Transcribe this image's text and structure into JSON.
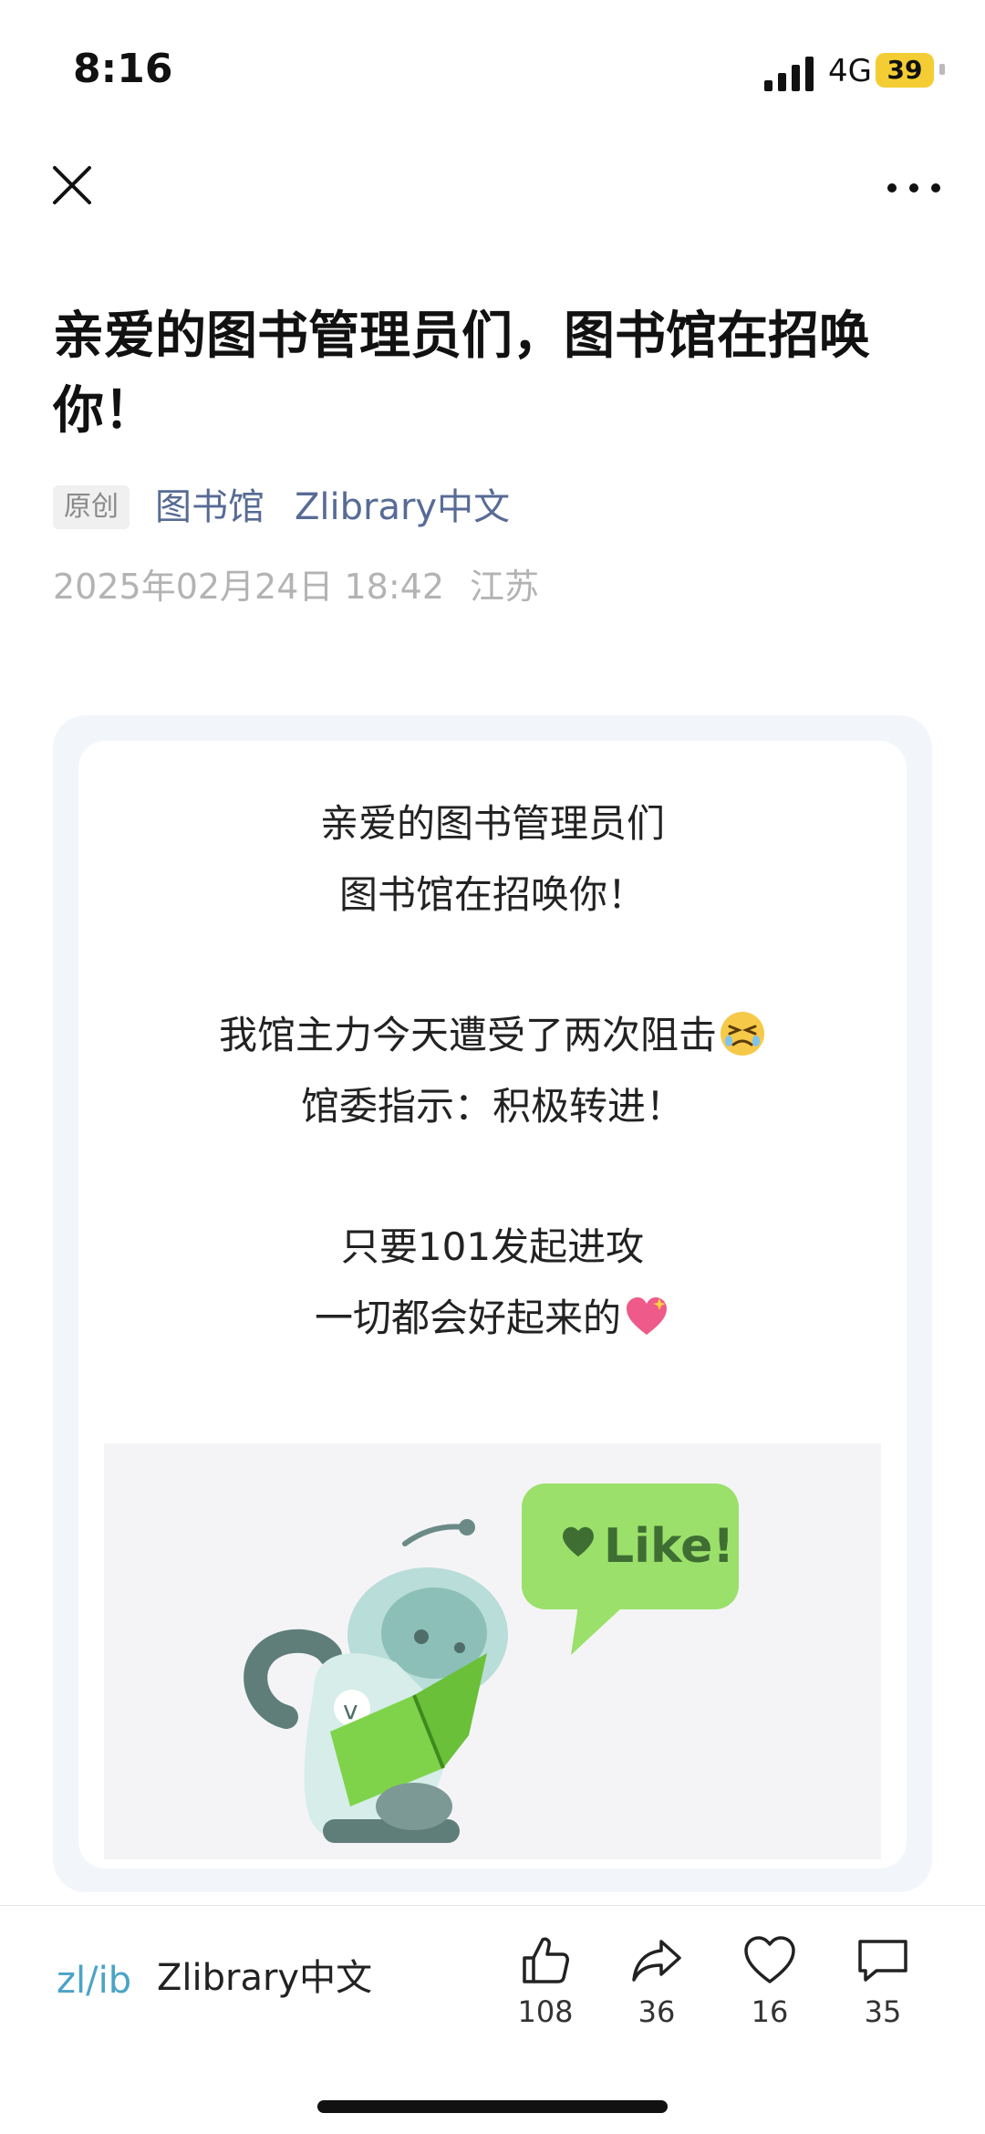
{
  "status_bar": {
    "time": "8:16",
    "network": "4G",
    "battery": "39"
  },
  "nav": {
    "close_icon": "close-icon",
    "more_icon": "more-icon"
  },
  "article": {
    "title": "亲爱的图书管理员们，图书馆在招唤你！",
    "tag": "原创",
    "author_link_1": "图书馆",
    "author_link_2": "Zlibrary中文",
    "date": "2025年02月24日 18:42",
    "location": "江苏"
  },
  "card": {
    "lines": [
      [
        "亲爱的图书管理员们",
        "图书馆在招唤你！"
      ],
      [
        "我馆主力今天遭受了两次阻击",
        "馆委指示：积极转进！"
      ],
      [
        "只要101发起进攻",
        "一切都会好起来的"
      ]
    ],
    "illustration_text": "Like!"
  },
  "footer": {
    "author_name": "Zlibrary中文",
    "logo_text": "zl/ib",
    "actions": [
      {
        "icon": "thumbs-up-icon",
        "count": "108"
      },
      {
        "icon": "share-icon",
        "count": "36"
      },
      {
        "icon": "heart-icon",
        "count": "16"
      },
      {
        "icon": "comment-icon",
        "count": "35"
      }
    ]
  },
  "colors": {
    "link": "#576b95",
    "meta": "#b3b3b3",
    "battery": "#f3cd33",
    "like_green": "#9be06a"
  }
}
